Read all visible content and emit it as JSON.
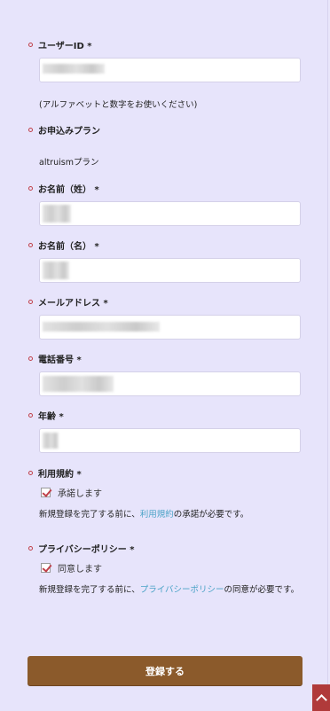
{
  "form": {
    "user_id": {
      "label": "ユーザーID *",
      "note": "(アルファベットと数字をお使いください)"
    },
    "plan": {
      "label": "お申込みプラン",
      "value": "altruismプラン"
    },
    "last_name": {
      "label": "お名前（姓） *"
    },
    "first_name": {
      "label": "お名前（名） *"
    },
    "email": {
      "label": "メールアドレス *"
    },
    "phone": {
      "label": "電話番号 *"
    },
    "age": {
      "label": "年齢 *"
    },
    "terms": {
      "label": "利用規約 *",
      "checkbox_label": "承諾します",
      "note_before": "新規登録を完了する前に、",
      "link": "利用規約",
      "note_after": "の承諾が必要です。"
    },
    "privacy": {
      "label": "プライバシーポリシー *",
      "checkbox_label": "同意します",
      "note_before": "新規登録を完了する前に、",
      "link": "プライバシーポリシー",
      "note_after": "の同意が必要です。"
    },
    "submit_label": "登録する"
  },
  "colors": {
    "background": "#e7e4fb",
    "submit": "#8b5a2b",
    "bullet": "#c0404a",
    "link": "#4ba3c7",
    "scroll_top": "#b03a3a"
  },
  "icons": {
    "scroll_top": "chevron-up-icon"
  }
}
